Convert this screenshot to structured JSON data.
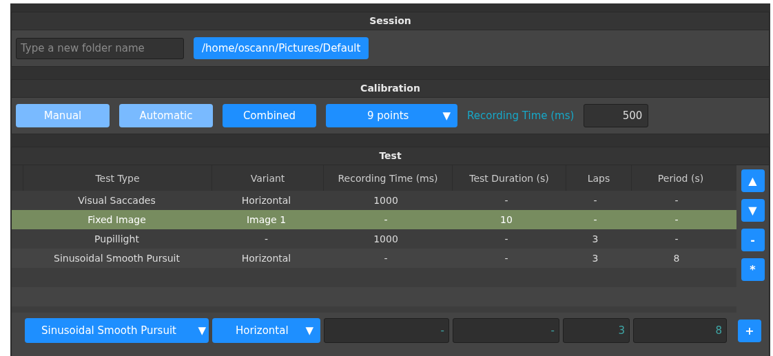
{
  "session": {
    "title": "Session",
    "folder_field": {
      "placeholder": "Type a new folder name"
    },
    "path_button": "/home/oscann/Pictures/Default"
  },
  "calibration": {
    "title": "Calibration",
    "modes": [
      {
        "label": "Manual",
        "selected": false
      },
      {
        "label": "Automatic",
        "selected": false
      },
      {
        "label": "Combined",
        "selected": true
      }
    ],
    "points_dropdown": {
      "value": "9 points",
      "arrow": "▼"
    },
    "recording_label": "Recording Time (ms)",
    "recording_value": "500"
  },
  "test": {
    "title": "Test",
    "table": {
      "columns": [
        "Test Type",
        "Variant",
        "Recording Time (ms)",
        "Test Duration (s)",
        "Laps",
        "Period (s)"
      ],
      "rows": [
        {
          "cells": [
            "Visual Saccades",
            "Horizontal",
            "1000",
            "-",
            "-",
            "-"
          ],
          "selected": false
        },
        {
          "cells": [
            "Fixed Image",
            "Image 1",
            "-",
            "10",
            "-",
            "-"
          ],
          "selected": true
        },
        {
          "cells": [
            "Pupillight",
            "-",
            "1000",
            "-",
            "3",
            "-"
          ],
          "selected": false
        },
        {
          "cells": [
            "Sinusoidal Smooth Pursuit",
            "Horizontal",
            "-",
            "-",
            "3",
            "8"
          ],
          "selected": false
        }
      ]
    },
    "side_buttons": [
      "▲",
      "▼",
      "-",
      "*"
    ],
    "editor": {
      "type_dropdown": {
        "value": "Sinusoidal Smooth Pursuit",
        "arrow": "▼"
      },
      "variant_dropdown": {
        "value": "Horizontal",
        "arrow": "▼"
      },
      "fields": [
        "-",
        "-",
        "3",
        "8"
      ],
      "add_button": "+"
    }
  }
}
